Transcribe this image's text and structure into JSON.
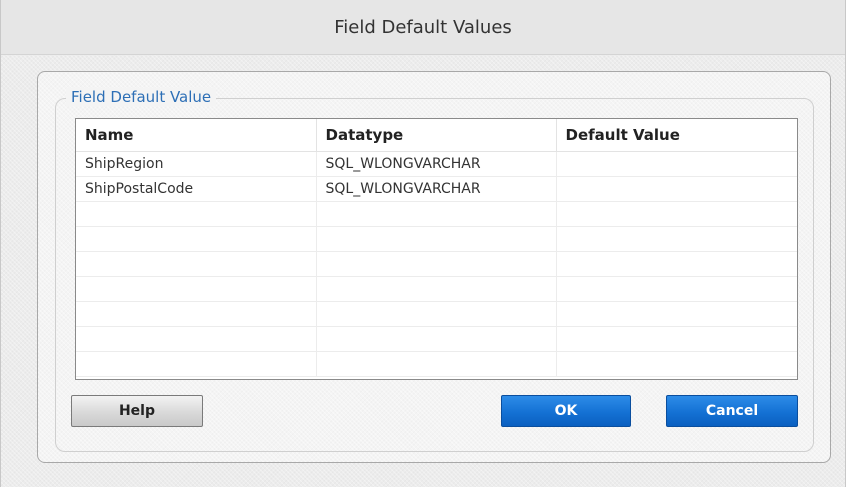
{
  "window": {
    "title": "Field Default Values"
  },
  "group": {
    "legend": "Field Default Value"
  },
  "table": {
    "columns": [
      "Name",
      "Datatype",
      "Default Value"
    ],
    "rows": [
      [
        "ShipRegion",
        "SQL_WLONGVARCHAR",
        ""
      ],
      [
        "ShipPostalCode",
        "SQL_WLONGVARCHAR",
        ""
      ],
      [
        "",
        "",
        ""
      ],
      [
        "",
        "",
        ""
      ],
      [
        "",
        "",
        ""
      ],
      [
        "",
        "",
        ""
      ],
      [
        "",
        "",
        ""
      ],
      [
        "",
        "",
        ""
      ],
      [
        "",
        "",
        ""
      ]
    ]
  },
  "buttons": {
    "help": "Help",
    "ok": "OK",
    "cancel": "Cancel"
  },
  "colors": {
    "legend_text": "#2d6fb6",
    "primary_button": "#1471d4",
    "secondary_button": "#d9d9d9"
  }
}
